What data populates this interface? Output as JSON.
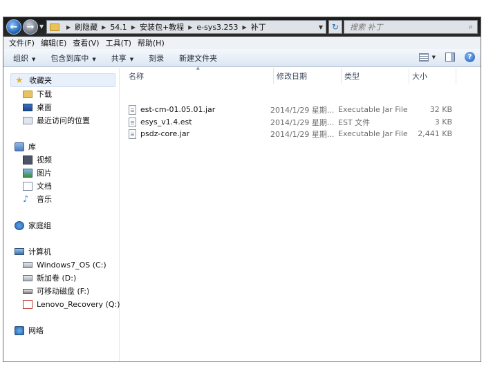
{
  "address_bar": {
    "breadcrumbs": [
      "刷隐藏",
      "54.1",
      "安装包+教程",
      "e-sys3.253",
      "补丁"
    ],
    "search_placeholder": "搜索 补丁"
  },
  "menu": [
    "文件(F)",
    "编辑(E)",
    "查看(V)",
    "工具(T)",
    "帮助(H)"
  ],
  "command_bar": {
    "organize": "组织",
    "include_in_library": "包含到库中",
    "share": "共享",
    "burn": "刻录",
    "new_folder": "新建文件夹"
  },
  "nav_pane": {
    "favorites": {
      "label": "收藏夹",
      "items": [
        "下载",
        "桌面",
        "最近访问的位置"
      ]
    },
    "libraries": {
      "label": "库",
      "items": [
        "视频",
        "图片",
        "文档",
        "音乐"
      ]
    },
    "homegroup": "家庭组",
    "computer": {
      "label": "计算机",
      "items": [
        "Windows7_OS (C:)",
        "新加卷 (D:)",
        "可移动磁盘 (F:)",
        "Lenovo_Recovery (Q:)"
      ]
    },
    "network": "网络"
  },
  "columns": {
    "name": "名称",
    "date": "修改日期",
    "type": "类型",
    "size": "大小"
  },
  "files": [
    {
      "name": "est-cm-01.05.01.jar",
      "date": "2014/1/29 星期...",
      "type": "Executable Jar File",
      "size": "32 KB"
    },
    {
      "name": "esys_v1.4.est",
      "date": "2014/1/29 星期...",
      "type": "EST 文件",
      "size": "3 KB"
    },
    {
      "name": "psdz-core.jar",
      "date": "2014/1/29 星期...",
      "type": "Executable Jar File",
      "size": "2,441 KB"
    }
  ]
}
